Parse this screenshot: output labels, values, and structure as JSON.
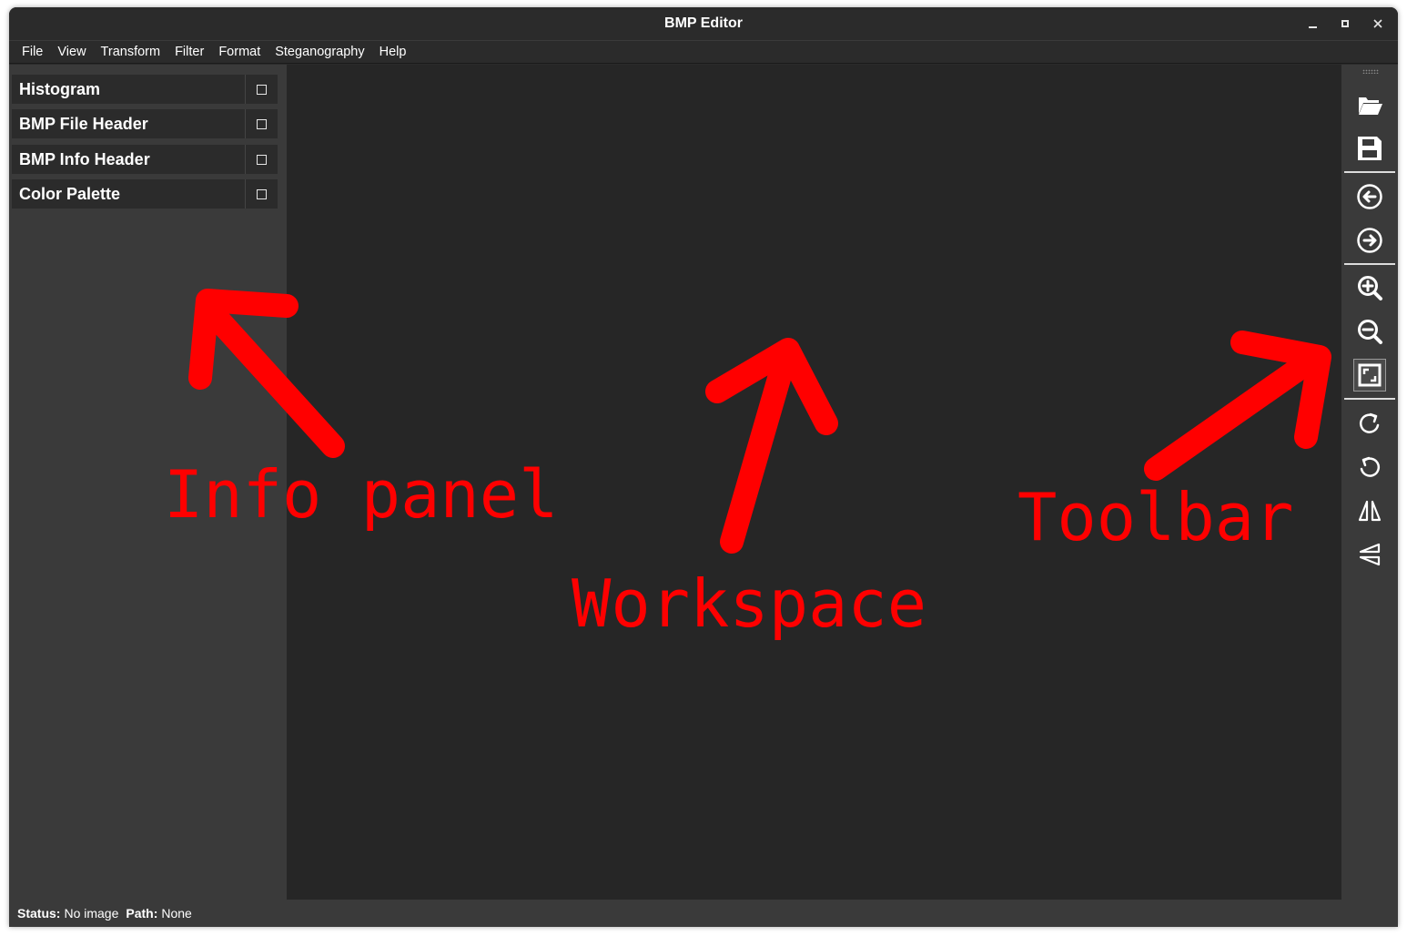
{
  "window": {
    "title": "BMP Editor"
  },
  "menu": [
    "File",
    "View",
    "Transform",
    "Filter",
    "Format",
    "Steganography",
    "Help"
  ],
  "info_panel": {
    "items": [
      {
        "label": "Histogram"
      },
      {
        "label": "BMP File Header"
      },
      {
        "label": "BMP Info Header"
      },
      {
        "label": "Color Palette"
      }
    ]
  },
  "toolbar": {
    "buttons": [
      "folder-open-icon",
      "save-icon",
      "undo-icon",
      "redo-icon",
      "zoom-in-icon",
      "zoom-out-icon",
      "fit-to-window-icon",
      "rotate-clockwise-icon",
      "rotate-counterclockwise-icon",
      "flip-horizontal-icon",
      "flip-vertical-icon"
    ]
  },
  "status": {
    "status_label": "Status:",
    "status_value": "No image",
    "path_label": "Path:",
    "path_value": "None"
  },
  "annotations": {
    "info_panel": "Info panel",
    "workspace": "Workspace",
    "toolbar": "Toolbar",
    "color": "#ff0000"
  }
}
